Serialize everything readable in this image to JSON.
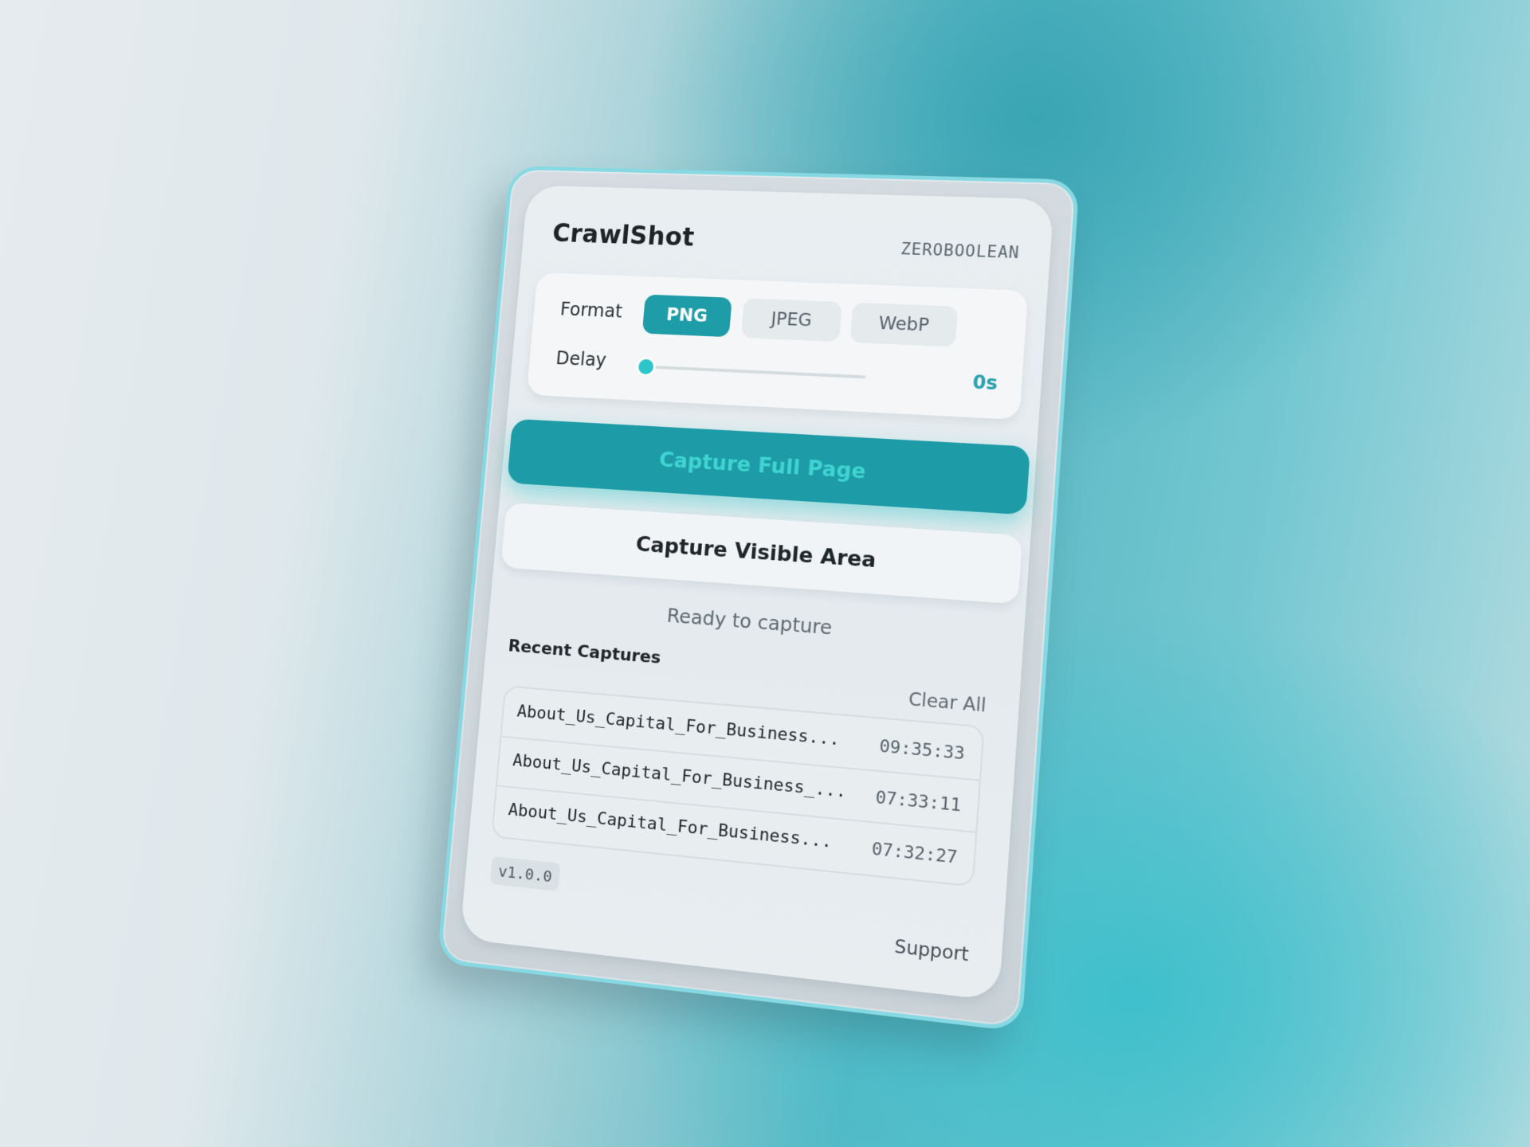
{
  "app": {
    "title": "CrawlShot",
    "brand": "ZEROBOOLEAN"
  },
  "settings": {
    "format_label": "Format",
    "formats": [
      {
        "label": "PNG",
        "active": true
      },
      {
        "label": "JPEG",
        "active": false
      },
      {
        "label": "WebP",
        "active": false
      }
    ],
    "delay_label": "Delay",
    "delay_value": "0s",
    "delay_level": 0
  },
  "actions": {
    "capture_full": "Capture Full Page",
    "capture_visible": "Capture Visible Area"
  },
  "status": "Ready to capture",
  "recent": {
    "title": "Recent Captures",
    "clear_label": "Clear All",
    "items": [
      {
        "name": "About_Us_Capital_For_Business...",
        "time": "09:35:33"
      },
      {
        "name": "About_Us_Capital_For_Business_...",
        "time": "07:33:11"
      },
      {
        "name": "About_Us_Capital_For_Business...",
        "time": "07:32:27"
      }
    ]
  },
  "footer": {
    "version": "v1.0.0",
    "support": "Support"
  },
  "colors": {
    "accent": "#1e9ca8",
    "accent_glow": "#3fd4d2",
    "slider_thumb": "#2cc5c8",
    "frame_border": "#86d9e3"
  }
}
